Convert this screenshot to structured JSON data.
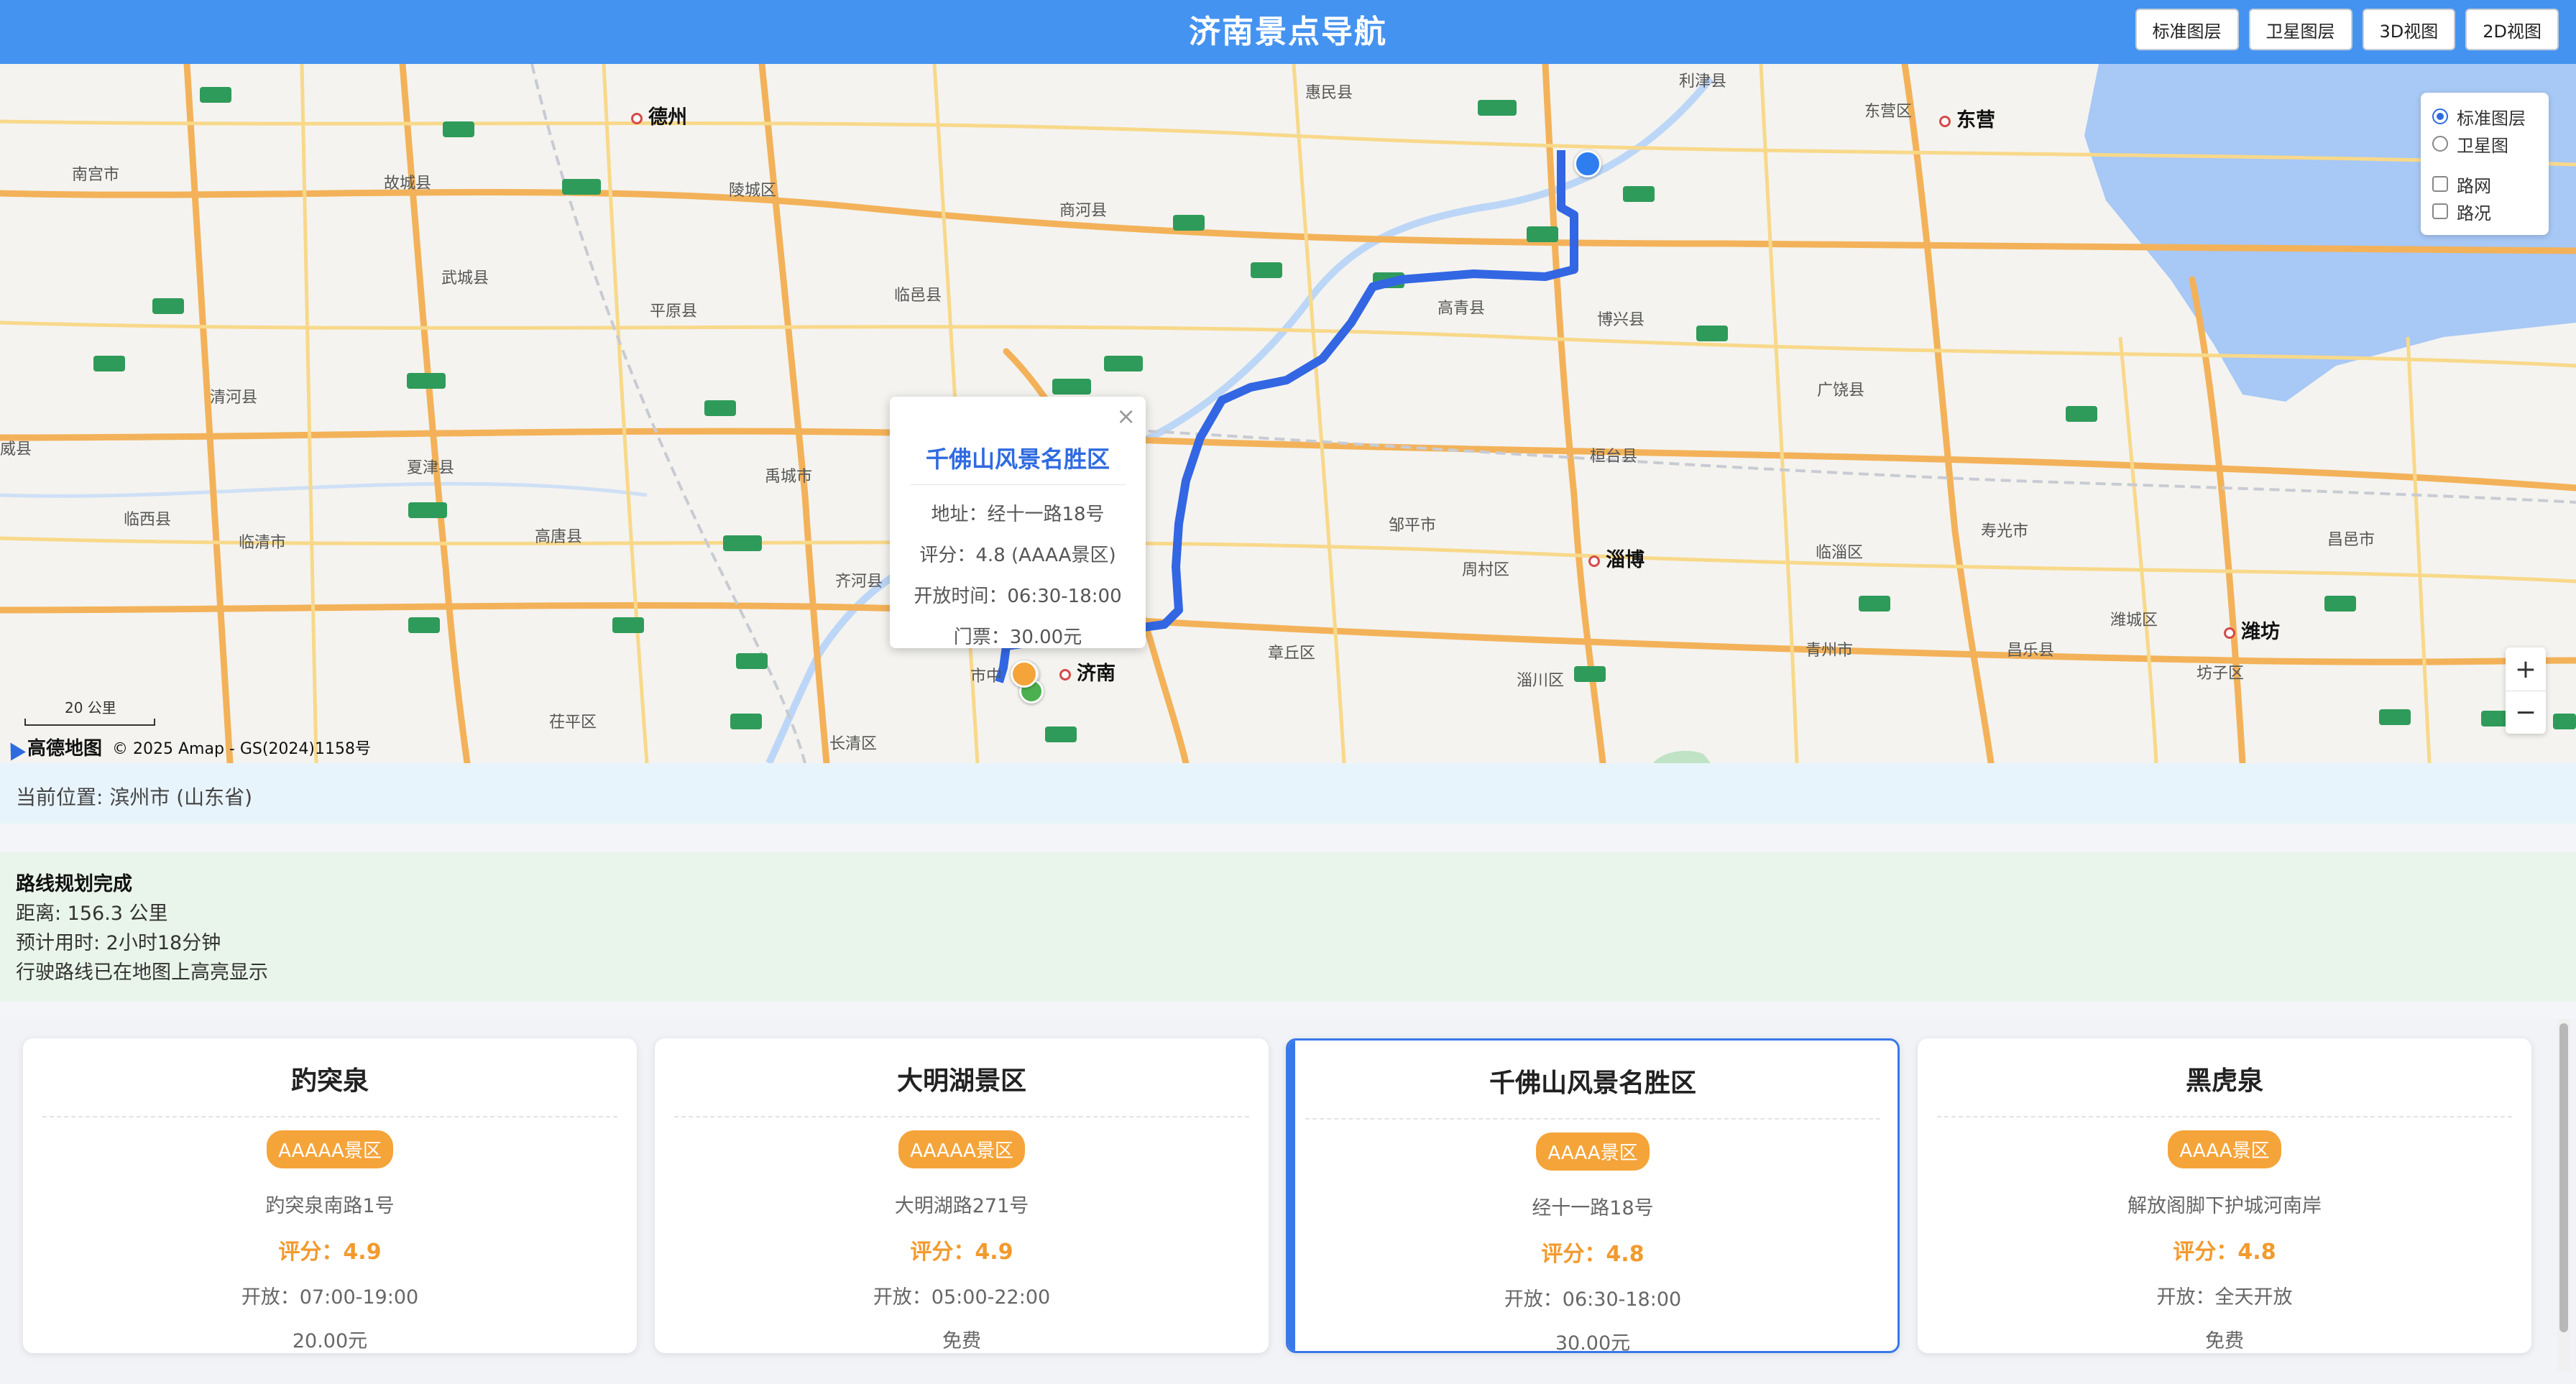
{
  "header": {
    "title": "济南景点导航",
    "buttons": [
      "标准图层",
      "卫星图层",
      "3D视图",
      "2D视图"
    ]
  },
  "map": {
    "places": [
      {
        "name": "德州",
        "city": true
      },
      {
        "name": "东营",
        "city": true
      },
      {
        "name": "淄博",
        "city": true
      },
      {
        "name": "潍坊",
        "city": true
      },
      {
        "name": "济南",
        "city": true
      },
      {
        "name": "惠民县"
      },
      {
        "name": "利津县"
      },
      {
        "name": "东营区"
      },
      {
        "name": "南宫市"
      },
      {
        "name": "故城县"
      },
      {
        "name": "陵城区"
      },
      {
        "name": "商河县"
      },
      {
        "name": "武城县"
      },
      {
        "name": "平原县"
      },
      {
        "name": "临邑县"
      },
      {
        "name": "高青县"
      },
      {
        "name": "博兴县"
      },
      {
        "name": "清河县"
      },
      {
        "name": "广饶县"
      },
      {
        "name": "夏津县"
      },
      {
        "name": "禹城市"
      },
      {
        "name": "桓台县"
      },
      {
        "name": "临西县"
      },
      {
        "name": "临清市"
      },
      {
        "name": "高唐县"
      },
      {
        "name": "邹平市"
      },
      {
        "name": "寿光市"
      },
      {
        "name": "昌邑市"
      },
      {
        "name": "齐河县"
      },
      {
        "name": "周村区"
      },
      {
        "name": "临淄区"
      },
      {
        "name": "章丘区"
      },
      {
        "name": "青州市"
      },
      {
        "name": "昌乐县"
      },
      {
        "name": "潍城区"
      },
      {
        "name": "淄川区"
      },
      {
        "name": "坊子区"
      },
      {
        "name": "茌平区"
      },
      {
        "name": "长清区"
      },
      {
        "name": "威县"
      },
      {
        "name": "市中"
      }
    ],
    "layer_panel": {
      "radios": [
        {
          "label": "标准图层",
          "checked": true
        },
        {
          "label": "卫星图",
          "checked": false
        }
      ],
      "checks": [
        {
          "label": "路网",
          "checked": false
        },
        {
          "label": "路况",
          "checked": false
        }
      ]
    },
    "zoom_in": "+",
    "zoom_out": "−",
    "scale_label": "20 公里",
    "logo": "高德地图",
    "copyright": "© 2025 Amap - GS(2024)1158号",
    "popup": {
      "close": "×",
      "title": "千佛山风景名胜区",
      "address": "地址：经十一路18号",
      "rating": "评分：4.8 (AAAA景区)",
      "hours": "开放时间：06:30-18:00",
      "ticket": "门票：30.00元"
    },
    "colors": {
      "route": "#3266e3",
      "origin_marker": "#2e7ef0",
      "water": "#a8c8f5"
    }
  },
  "location_bar": {
    "text": "当前位置: 滨州市 (山东省)"
  },
  "route": {
    "title": "路线规划完成",
    "distance": "距离: 156.3 公里",
    "duration": "预计用时: 2小时18分钟",
    "note": "行驶路线已在地图上高亮显示"
  },
  "cards": [
    {
      "name": "趵突泉",
      "level": "AAAAA景区",
      "address": "趵突泉南路1号",
      "rating": "评分：4.9",
      "hours": "开放：07:00-19:00",
      "price": "20.00元",
      "active": false
    },
    {
      "name": "大明湖景区",
      "level": "AAAAA景区",
      "address": "大明湖路271号",
      "rating": "评分：4.9",
      "hours": "开放：05:00-22:00",
      "price": "免费",
      "active": false
    },
    {
      "name": "千佛山风景名胜区",
      "level": "AAAA景区",
      "address": "经十一路18号",
      "rating": "评分：4.8",
      "hours": "开放：06:30-18:00",
      "price": "30.00元",
      "active": true
    },
    {
      "name": "黑虎泉",
      "level": "AAAA景区",
      "address": "解放阁脚下护城河南岸",
      "rating": "评分：4.8",
      "hours": "开放：全天开放",
      "price": "免费",
      "active": false
    }
  ]
}
